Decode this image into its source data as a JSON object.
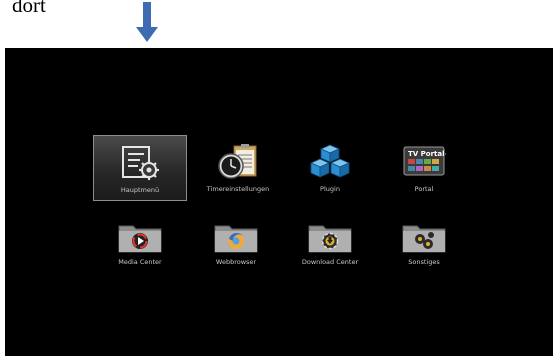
{
  "caption": {
    "text": "dort"
  },
  "menu": {
    "items": [
      {
        "label": "Hauptmenü",
        "icon": "settings-document-icon",
        "selected": true
      },
      {
        "label": "Timereinstellungen",
        "icon": "clock-calendar-icon"
      },
      {
        "label": "Plugin",
        "icon": "cubes-icon"
      },
      {
        "label": "Portal",
        "icon": "tv-portal-icon"
      },
      {
        "label": "Media Center",
        "icon": "media-folder-icon"
      },
      {
        "label": "Webbrowser",
        "icon": "browser-folder-icon"
      },
      {
        "label": "Download Center",
        "icon": "download-folder-icon"
      },
      {
        "label": "Sonstiges",
        "icon": "misc-folder-icon"
      }
    ],
    "portal_badge": "TV Portal+"
  },
  "colors": {
    "arrow": "#3d6cb3",
    "screen_bg": "#000000",
    "label": "#c9c9c9"
  }
}
